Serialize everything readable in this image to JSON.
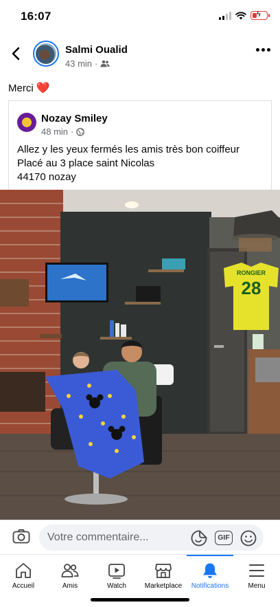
{
  "status": {
    "time": "16:07"
  },
  "post": {
    "author": "Salmi Oualid",
    "time": "43 min",
    "text": "Merci",
    "emoji": "❤️",
    "audience_icon": "friends-icon"
  },
  "shared": {
    "author": "Nozay Smiley",
    "time": "48 min",
    "audience_icon": "globe-icon",
    "text": "Allez y les yeux fermés les amis très bon coiffeur\nPlacé au 3 place saint Nicolas\n44170 nozay"
  },
  "photo": {
    "jersey_name": "RONGIER",
    "jersey_number": "28"
  },
  "comment": {
    "placeholder": "Votre commentaire...",
    "gif_label": "GIF"
  },
  "nav": [
    {
      "label": "Accueil",
      "icon": "home-icon"
    },
    {
      "label": "Amis",
      "icon": "friends-icon"
    },
    {
      "label": "Watch",
      "icon": "watch-icon"
    },
    {
      "label": "Marketplace",
      "icon": "marketplace-icon"
    },
    {
      "label": "Notifications",
      "icon": "bell-icon"
    },
    {
      "label": "Menu",
      "icon": "menu-icon"
    }
  ],
  "colors": {
    "accent": "#1877f2",
    "heart": "#e53935",
    "battery": "#e53935"
  }
}
